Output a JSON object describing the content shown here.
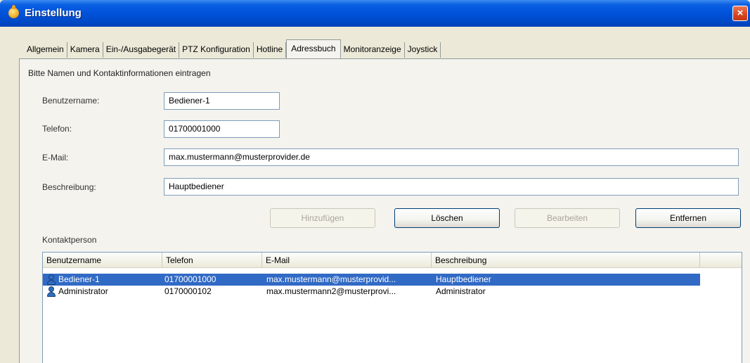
{
  "window": {
    "title": "Einstellung",
    "close_glyph": "×"
  },
  "tabs": [
    {
      "label": "Allgemein"
    },
    {
      "label": "Kamera"
    },
    {
      "label": "Ein-/Ausgabegerät"
    },
    {
      "label": "PTZ Konfiguration"
    },
    {
      "label": "Hotline"
    },
    {
      "label": "Adressbuch",
      "active": true
    },
    {
      "label": "Monitoranzeige"
    },
    {
      "label": "Joystick"
    }
  ],
  "form": {
    "intro": "Bitte Namen und Kontaktinformationen eintragen",
    "username_label": "Benutzername:",
    "username_value": "Bediener-1",
    "phone_label": "Telefon:",
    "phone_value": "01700001000",
    "email_label": "E-Mail:",
    "email_value": "max.mustermann@musterprovider.de",
    "description_label": "Beschreibung:",
    "description_value": "Hauptbediener"
  },
  "buttons": {
    "add": "Hinzufügen",
    "clear": "Löschen",
    "edit": "Bearbeiten",
    "remove": "Entfernen"
  },
  "contacts": {
    "group_label": "Kontaktperson",
    "columns": [
      "Benutzername",
      "Telefon",
      "E-Mail",
      "Beschreibung"
    ],
    "rows": [
      {
        "username": "Bediener-1",
        "phone": "01700001000",
        "email": "max.mustermann@musterprovid...",
        "description": "Hauptbediener",
        "selected": true,
        "icon": "user-icon"
      },
      {
        "username": "Administrator",
        "phone": "0170000102",
        "email": "max.mustermann2@musterprovi...",
        "description": "Administrator",
        "selected": false,
        "icon": "user-icon"
      }
    ]
  },
  "colors": {
    "titlebar": "#0052d9",
    "selection": "#316ac5",
    "panel": "#f4f3ee",
    "window_bg": "#ece9d8"
  }
}
